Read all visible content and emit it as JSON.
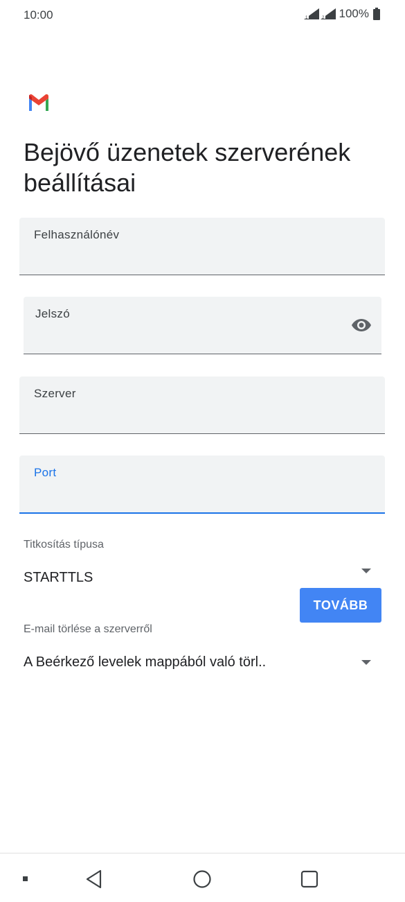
{
  "status": {
    "time": "10:00",
    "battery": "100%"
  },
  "icons": {
    "app": "gmail-logo",
    "visibility": "eye-icon",
    "dropdown": "chevron-down-icon",
    "nav_back": "back-triangle-icon",
    "nav_home": "home-circle-icon",
    "nav_recents": "recents-square-icon"
  },
  "page": {
    "title": "Bejövő üzenetek szerverének beállításai"
  },
  "fields": {
    "username": {
      "label": "Felhasználónév",
      "value": ""
    },
    "password": {
      "label": "Jelszó",
      "value": ""
    },
    "server": {
      "label": "Szerver",
      "value": ""
    },
    "port": {
      "label": "Port",
      "value": ""
    }
  },
  "security": {
    "label": "Titkosítás típusa",
    "value": "STARTTLS"
  },
  "delete": {
    "label": "E-mail törlése a szerverről",
    "value": "A Beérkező levelek mappából való törl.."
  },
  "actions": {
    "next": "TOVÁBB"
  },
  "colors": {
    "accent": "#1a73e8",
    "button": "#4285f4",
    "field_bg": "#f1f3f4"
  }
}
